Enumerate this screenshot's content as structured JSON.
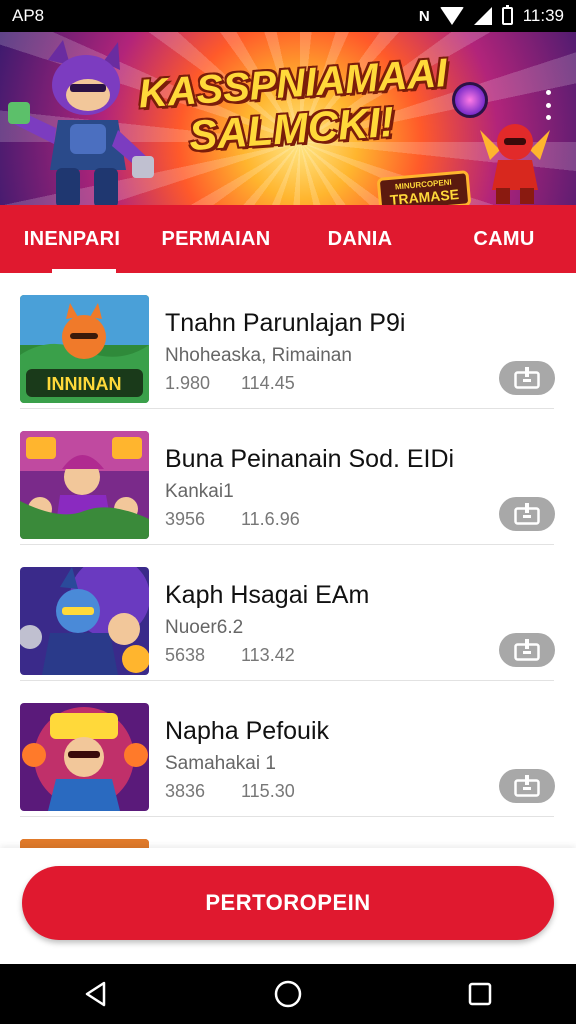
{
  "status_bar": {
    "left_text": "AP8",
    "nfc_label": "N",
    "time": "11:39"
  },
  "banner": {
    "title_line1": "KASSPNIAMAAI",
    "title_line2": "SALMCKI!",
    "badge_line1": "MINURCOPENI",
    "badge_line2": "TRAMASE"
  },
  "tabs": [
    {
      "label": "INENPARI",
      "active": true
    },
    {
      "label": "PERMAIAN",
      "active": false
    },
    {
      "label": "DANIA",
      "active": false
    },
    {
      "label": "CAMU",
      "active": false
    }
  ],
  "games": [
    {
      "title": "Tnahn Parunlajan P9i",
      "subtitle": "Nhoheaska, Rimainan",
      "stat1": "1.980",
      "stat2": "114.45",
      "thumb_text": "INNINAN",
      "thumb_bg": "#2f8a3a"
    },
    {
      "title": "Buna Peinanain Sod. EIDi",
      "subtitle": "Kankai1",
      "stat1": "3956",
      "stat2": "11.6.96",
      "thumb_text": "",
      "thumb_bg": "#7a2a8a"
    },
    {
      "title": "Kaph Hsagai EAm",
      "subtitle": "Nuoer6.2",
      "stat1": "5638",
      "stat2": "113.42",
      "thumb_text": "",
      "thumb_bg": "#3a2a8a"
    },
    {
      "title": "Napha Pefouik",
      "subtitle": "Samahakai 1",
      "stat1": "3836",
      "stat2": "115.30",
      "thumb_text": "",
      "thumb_bg": "#5a1a7a"
    }
  ],
  "cta": {
    "label": "PERTOROPEIN"
  },
  "colors": {
    "accent": "#e0192f",
    "download_button": "#a8a8a8"
  },
  "icons": {
    "download": "download-box-icon",
    "menu": "more-vertical-icon",
    "nav_back": "back-triangle-icon",
    "nav_home": "home-circle-icon",
    "nav_recents": "recents-square-icon"
  }
}
